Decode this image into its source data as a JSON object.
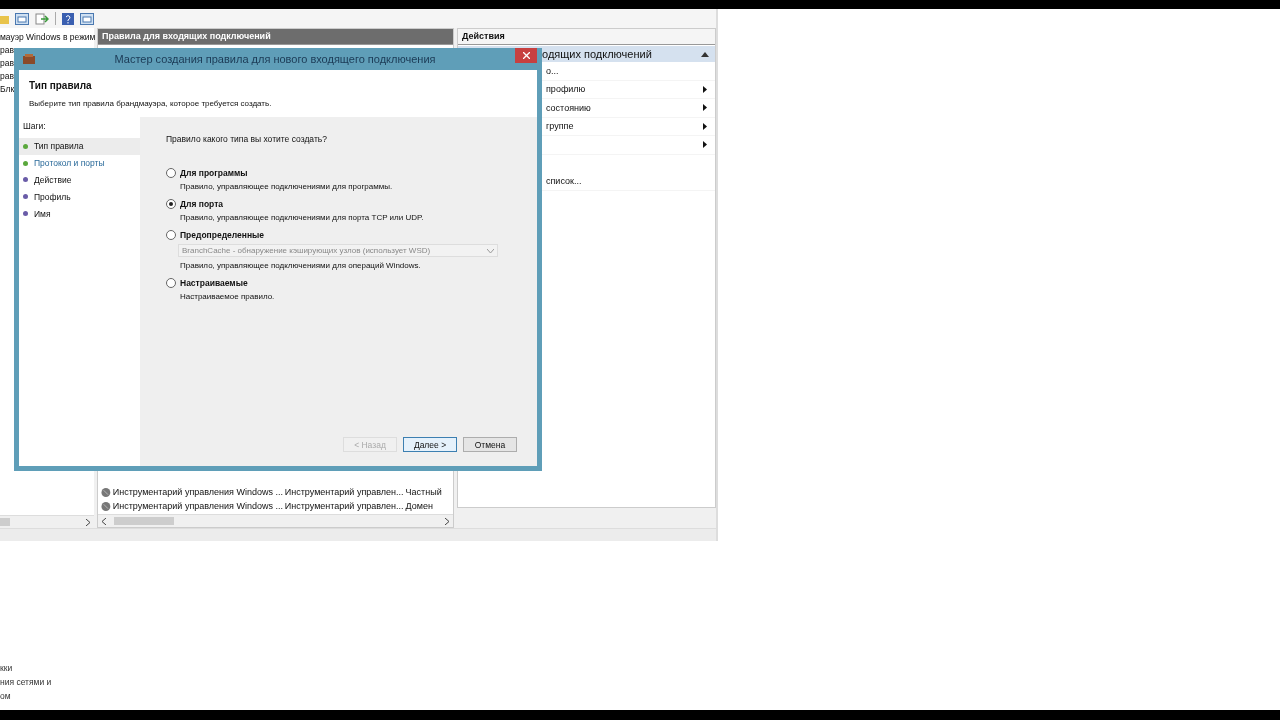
{
  "tree": {
    "items": [
      "мауэр Windows в режим",
      "рав",
      "рав",
      "рав",
      "Блк"
    ]
  },
  "rules_panel": {
    "title": "Правила для входящих подключений",
    "rows": [
      {
        "name": "Инструментарий управления Windows ...",
        "group": "Инструментарий управлен...",
        "profile": "Частный"
      },
      {
        "name": "Инструментарий управления Windows ...",
        "group": "Инструментарий управлен...",
        "profile": "Домен"
      }
    ]
  },
  "actions_panel": {
    "title": "Действия",
    "section": "одящих подключений",
    "items": [
      {
        "label": "о...",
        "submenu": false
      },
      {
        "label": "профилю",
        "submenu": true
      },
      {
        "label": "состоянию",
        "submenu": true
      },
      {
        "label": "группе",
        "submenu": true
      },
      {
        "submenu": true
      },
      {
        "label": "список...",
        "submenu": false
      }
    ]
  },
  "fragments": [
    "кки",
    "ния сетями и",
    "ом"
  ],
  "dialog": {
    "title": "Мастер создания правила для нового входящего подключения",
    "heading": "Тип правила",
    "subtitle": "Выберите тип правила брандмауэра, которое требуется создать.",
    "steps_title": "Шаги:",
    "steps": [
      {
        "label": "Тип правила",
        "selected": true,
        "highlighted": false,
        "color": "#5aa83c"
      },
      {
        "label": "Протокол и порты",
        "selected": false,
        "highlighted": true,
        "color": "#5aa83c"
      },
      {
        "label": "Действие",
        "selected": false,
        "highlighted": false,
        "color": "#6a5ca8"
      },
      {
        "label": "Профиль",
        "selected": false,
        "highlighted": false,
        "color": "#6a5ca8"
      },
      {
        "label": "Имя",
        "selected": false,
        "highlighted": false,
        "color": "#6a5ca8"
      }
    ],
    "question": "Правило какого типа вы хотите создать?",
    "options": [
      {
        "label": "Для программы",
        "description": "Правило, управляющее подключениями для программы.",
        "selected": false
      },
      {
        "label": "Для порта",
        "description": "Правило, управляющее подключениями для порта TCP или UDP.",
        "selected": true
      },
      {
        "label": "Предопределенные",
        "dropdown": {
          "value": "BranchCache - обнаружение кэширующих узлов (использует WSD)",
          "disabled": true
        },
        "description": "Правило, управляющее подключениями для операций Windows.",
        "selected": false
      },
      {
        "label": "Настраиваемые",
        "description": "Настраиваемое правило.",
        "selected": false
      }
    ],
    "buttons": [
      {
        "label": "< Назад",
        "disabled": true,
        "default": false
      },
      {
        "label": "Далее >",
        "disabled": false,
        "default": true
      },
      {
        "label": "Отмена",
        "disabled": false,
        "default": false
      }
    ]
  }
}
